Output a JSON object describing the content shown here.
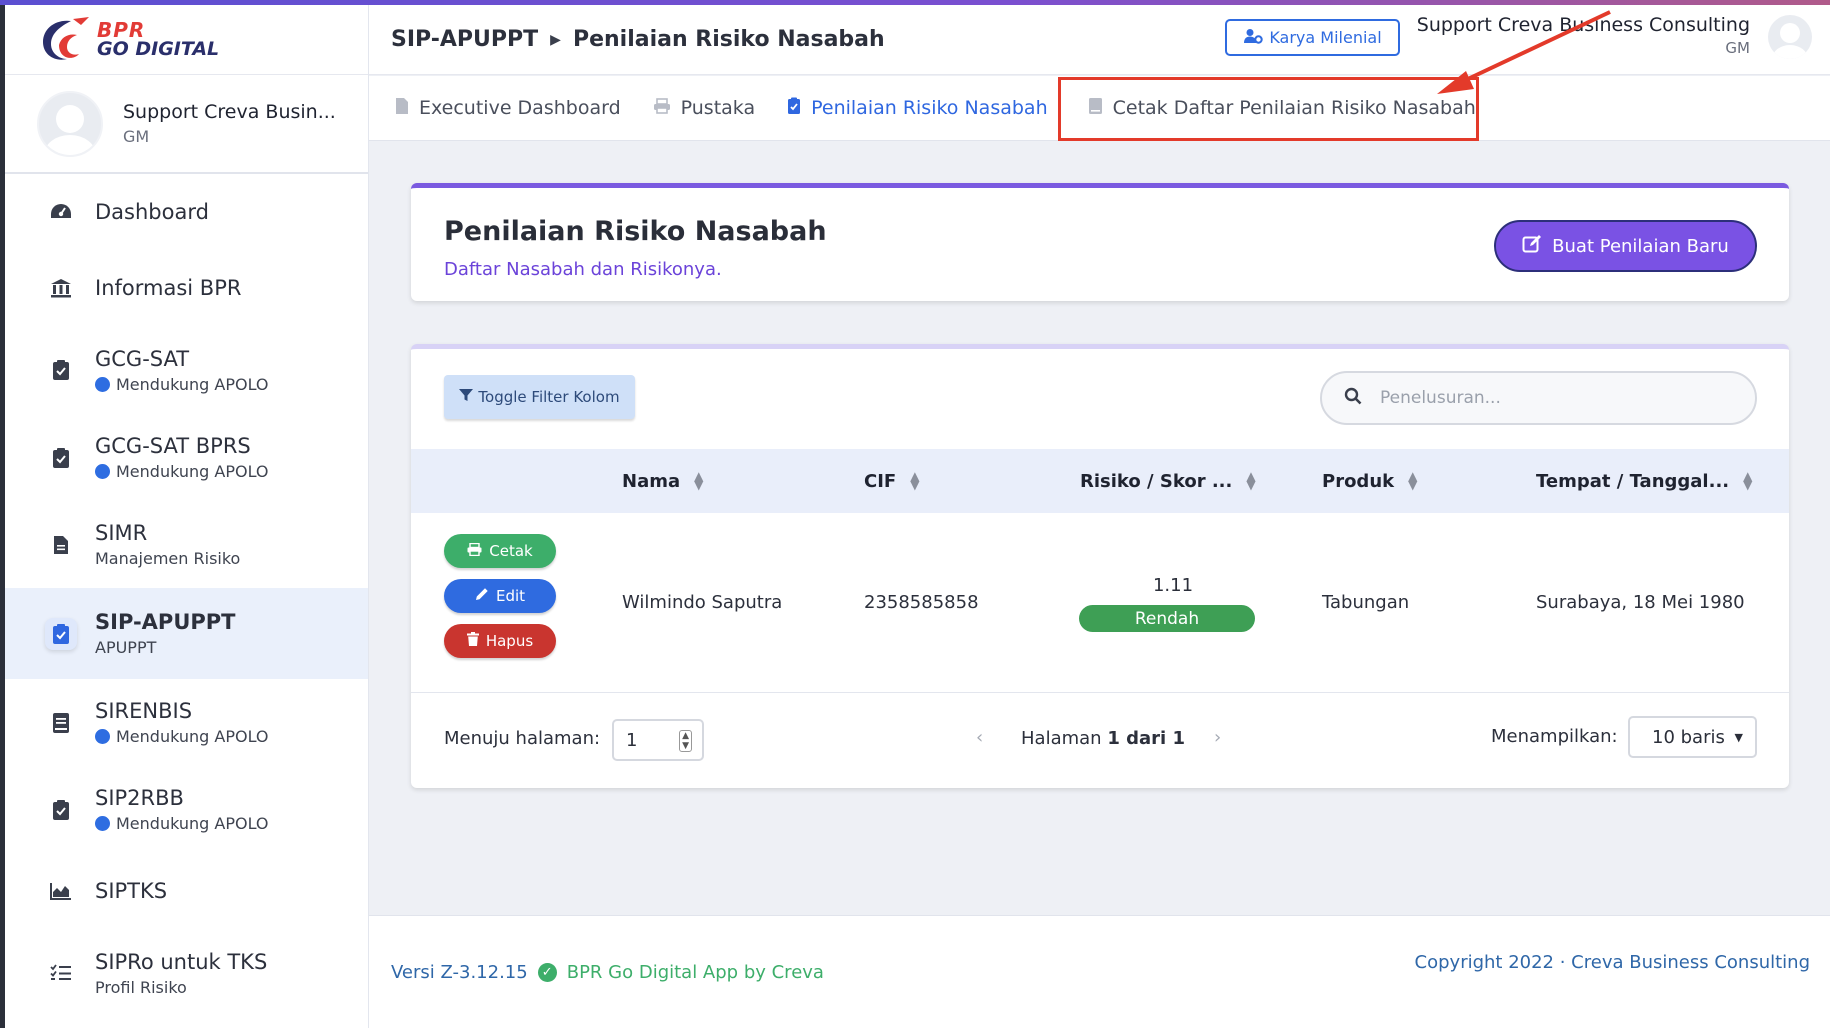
{
  "brand": {
    "line1": "BPR",
    "line2": "GO DIGITAL"
  },
  "colors": {
    "accent": "#2f67e0",
    "purple": "#7a52e4",
    "annotation": "#e33a2a",
    "success": "#3dae6a",
    "danger": "#c9352f"
  },
  "user": {
    "name": "Support Creva Busin...",
    "role": "GM",
    "full_name": "Support Creva Business Consulting"
  },
  "sidebar": {
    "items": [
      {
        "title": "Dashboard",
        "icon": "gauge-icon"
      },
      {
        "title": "Informasi BPR",
        "icon": "bank-icon"
      },
      {
        "title": "GCG-SAT",
        "sub": "Mendukung APOLO",
        "icon": "clipboard-check-icon"
      },
      {
        "title": "GCG-SAT BPRS",
        "sub": "Mendukung APOLO",
        "icon": "clipboard-check-icon"
      },
      {
        "title": "SIMR",
        "sub": "Manajemen Risiko",
        "icon": "document-icon"
      },
      {
        "title": "SIP-APUPPT",
        "sub": "APUPPT",
        "icon": "clipboard-check-icon"
      },
      {
        "title": "SIRENBIS",
        "sub": "Mendukung APOLO",
        "icon": "book-icon"
      },
      {
        "title": "SIP2RBB",
        "sub": "Mendukung APOLO",
        "icon": "clipboard-check-icon"
      },
      {
        "title": "SIPTKS",
        "icon": "area-chart-icon"
      },
      {
        "title": "SIPRo untuk TKS",
        "sub": "Profil Risiko",
        "icon": "list-check-icon"
      }
    ]
  },
  "header": {
    "breadcrumb": [
      "SIP-APUPPT",
      "Penilaian Risiko Nasabah"
    ],
    "karya_btn": "Karya Milenial",
    "user_name": "Support Creva Business Consulting",
    "user_role": "GM"
  },
  "tabs": [
    {
      "label": "Executive Dashboard",
      "icon": "file-icon"
    },
    {
      "label": "Pustaka",
      "icon": "printer-icon"
    },
    {
      "label": "Penilaian Risiko Nasabah",
      "icon": "clipboard-check-icon",
      "active": true
    },
    {
      "label": "Cetak Daftar Penilaian Risiko Nasabah",
      "icon": "book-icon"
    }
  ],
  "page": {
    "title": "Penilaian Risiko Nasabah",
    "subtitle": "Daftar Nasabah dan Risikonya.",
    "new_btn": "Buat Penilaian Baru"
  },
  "table": {
    "toggle_filter": "Toggle Filter Kolom",
    "search_placeholder": "Penelusuran...",
    "columns": [
      "Nama",
      "CIF",
      "Risiko / Skor ...",
      "Produk",
      "Tempat / Tanggal..."
    ],
    "actions": {
      "print": "Cetak",
      "edit": "Edit",
      "delete": "Hapus"
    },
    "rows": [
      {
        "nama": "Wilmindo Saputra",
        "cif": "2358585858",
        "skor": "1.11",
        "risiko": "Rendah",
        "produk": "Tabungan",
        "ttl": "Surabaya, 18 Mei 1980"
      }
    ]
  },
  "pagination": {
    "goto_label": "Menuju halaman:",
    "goto_value": "1",
    "page_prefix": "Halaman",
    "page_info": "1 dari 1",
    "show_label": "Menampilkan:",
    "show_value": "10 baris"
  },
  "footer": {
    "version": "Versi Z-3.12.15",
    "app": "BPR Go Digital App by Creva",
    "copyright": "Copyright 2022 · Creva Business Consulting"
  }
}
